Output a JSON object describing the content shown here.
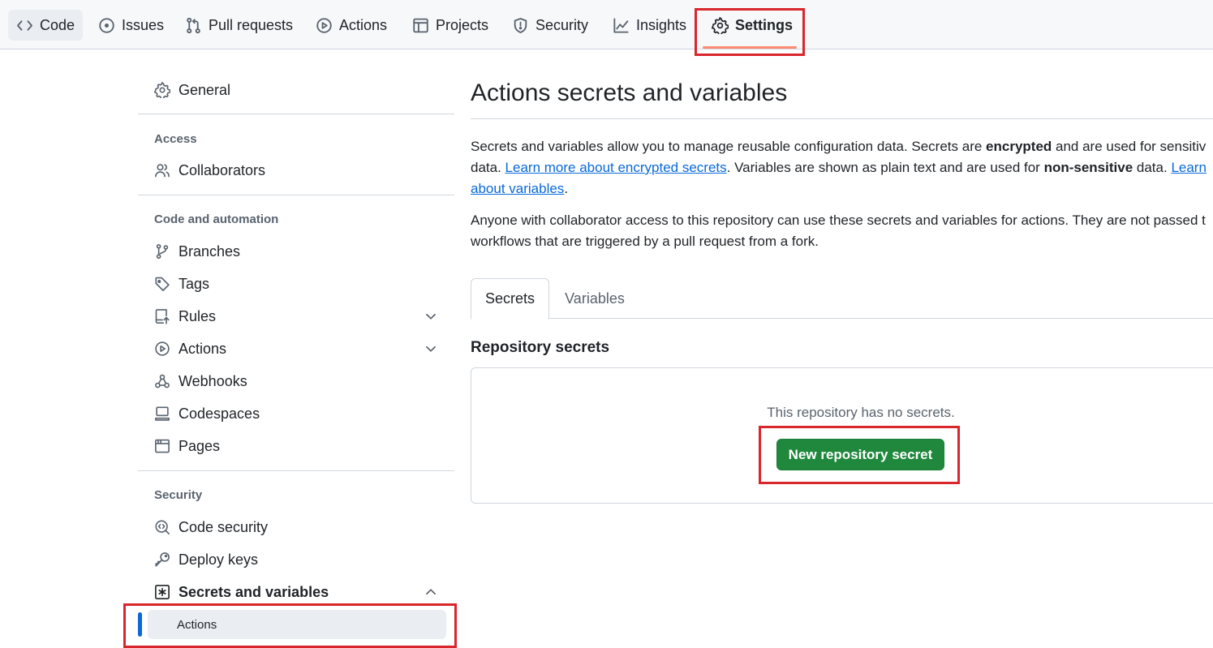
{
  "nav": {
    "items": [
      {
        "label": "Code",
        "icon": "code-icon"
      },
      {
        "label": "Issues",
        "icon": "issue-opened-icon"
      },
      {
        "label": "Pull requests",
        "icon": "git-pull-request-icon"
      },
      {
        "label": "Actions",
        "icon": "play-icon"
      },
      {
        "label": "Projects",
        "icon": "table-icon"
      },
      {
        "label": "Security",
        "icon": "shield-icon"
      },
      {
        "label": "Insights",
        "icon": "graph-icon"
      },
      {
        "label": "Settings",
        "icon": "gear-icon"
      }
    ],
    "active": "Settings"
  },
  "sidebar": {
    "general": "General",
    "access_heading": "Access",
    "collaborators": "Collaborators",
    "code_heading": "Code and automation",
    "branches": "Branches",
    "tags": "Tags",
    "rules": "Rules",
    "actions": "Actions",
    "webhooks": "Webhooks",
    "codespaces": "Codespaces",
    "pages": "Pages",
    "security_heading": "Security",
    "code_security": "Code security",
    "deploy_keys": "Deploy keys",
    "secrets_and_variables": "Secrets and variables",
    "secrets_actions": "Actions"
  },
  "main": {
    "title": "Actions secrets and variables",
    "desc1_a": "Secrets and variables allow you to manage reusable configuration data. Secrets are ",
    "desc1_b": "encrypted",
    "desc1_c": " and are used for sensitiv",
    "desc2_a": "data. ",
    "desc2_link": "Learn more about encrypted secrets",
    "desc2_b": ". Variables are shown as plain text and are used for ",
    "desc2_c": "non-sensitive",
    "desc2_d": " data. ",
    "desc2_link2": "Learn",
    "desc3_link": "about variables",
    "desc3_b": ".",
    "desc4": "Anyone with collaborator access to this repository can use these secrets and variables for actions. They are not passed t",
    "desc5": "workflows that are triggered by a pull request from a fork.",
    "tabs": [
      "Secrets",
      "Variables"
    ],
    "section_title": "Repository secrets",
    "empty_text": "This repository has no secrets.",
    "new_secret_button": "New repository secret"
  },
  "colors": {
    "accent": "#0969da",
    "primary_button": "#1f883d",
    "highlight_box": "#d9262c",
    "active_tab_underline": "#fd8c73"
  }
}
